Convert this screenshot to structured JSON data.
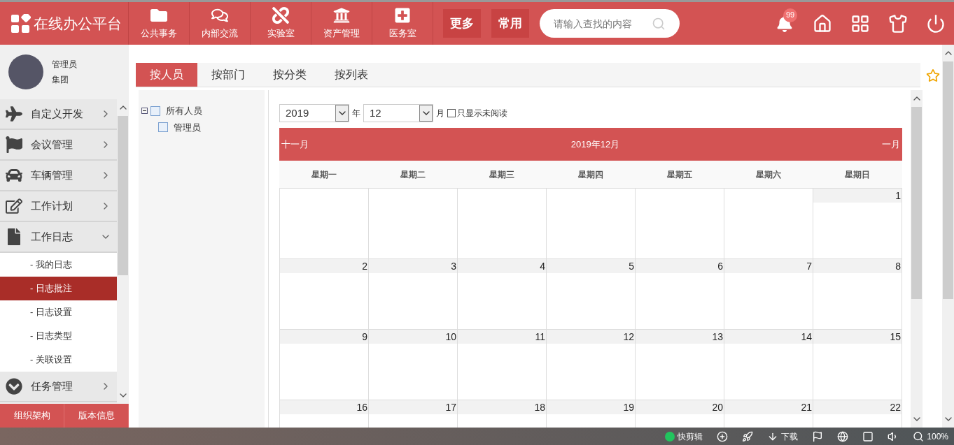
{
  "header": {
    "logo": "在线办公平台",
    "nav": [
      {
        "label": "公共事务"
      },
      {
        "label": "内部交流"
      },
      {
        "label": "实验室"
      },
      {
        "label": "资产管理"
      },
      {
        "label": "医务室"
      }
    ],
    "buttons": [
      {
        "label": "更多"
      },
      {
        "label": "常用"
      }
    ],
    "search": {
      "placeholder": "请输入查找的内容"
    },
    "notification_badge": "99"
  },
  "user": {
    "name": "管理员",
    "org": "集团"
  },
  "sidebar": {
    "items": [
      {
        "label": "自定义开发",
        "expanded": false
      },
      {
        "label": "会议管理",
        "expanded": false
      },
      {
        "label": "车辆管理",
        "expanded": false
      },
      {
        "label": "工作计划",
        "expanded": false
      },
      {
        "label": "工作日志",
        "expanded": true,
        "children": [
          {
            "label": "- 我的日志",
            "selected": false
          },
          {
            "label": "- 日志批注",
            "selected": true
          },
          {
            "label": "- 日志设置",
            "selected": false
          },
          {
            "label": "- 日志类型",
            "selected": false
          },
          {
            "label": "- 关联设置",
            "selected": false
          }
        ]
      },
      {
        "label": "任务管理",
        "expanded": false
      }
    ],
    "footer": [
      {
        "label": "组织架构"
      },
      {
        "label": "版本信息"
      }
    ]
  },
  "tabs": [
    {
      "label": "按人员",
      "selected": true
    },
    {
      "label": "按部门",
      "selected": false
    },
    {
      "label": "按分类",
      "selected": false
    },
    {
      "label": "按列表",
      "selected": false
    }
  ],
  "tree": {
    "label": "所有人员",
    "expanded": true,
    "children": [
      {
        "label": "管理员"
      }
    ]
  },
  "filter": {
    "year": "2019",
    "year_unit": "年",
    "month": "12",
    "month_unit": "月",
    "unread_only": {
      "label": "只显示未阅读",
      "checked": false
    }
  },
  "calendar": {
    "prev": "十一月",
    "title": "2019年12月",
    "next": "一月",
    "weekdays": [
      "星期一",
      "星期二",
      "星期三",
      "星期四",
      "星期五",
      "星期六",
      "星期日"
    ],
    "weeks": [
      [
        {
          "kind": "empty"
        },
        {
          "kind": "empty"
        },
        {
          "kind": "empty"
        },
        {
          "kind": "empty"
        },
        {
          "kind": "empty"
        },
        {
          "kind": "empty"
        },
        {
          "kind": "day",
          "day": "1"
        }
      ],
      [
        {
          "kind": "day",
          "day": "2"
        },
        {
          "kind": "day",
          "day": "3"
        },
        {
          "kind": "day",
          "day": "4"
        },
        {
          "kind": "day",
          "day": "5"
        },
        {
          "kind": "day",
          "day": "6"
        },
        {
          "kind": "day",
          "day": "7"
        },
        {
          "kind": "day",
          "day": "8"
        }
      ],
      [
        {
          "kind": "day",
          "day": "9"
        },
        {
          "kind": "day",
          "day": "10"
        },
        {
          "kind": "day",
          "day": "11"
        },
        {
          "kind": "day",
          "day": "12"
        },
        {
          "kind": "day",
          "day": "13"
        },
        {
          "kind": "day",
          "day": "14"
        },
        {
          "kind": "day",
          "day": "15"
        }
      ],
      [
        {
          "kind": "day",
          "day": "16"
        },
        {
          "kind": "day",
          "day": "17"
        },
        {
          "kind": "day",
          "day": "18"
        },
        {
          "kind": "day",
          "day": "19"
        },
        {
          "kind": "day",
          "day": "20"
        },
        {
          "kind": "day",
          "day": "21"
        },
        {
          "kind": "day",
          "day": "22"
        }
      ]
    ]
  },
  "status_bar": {
    "app": "快剪辑",
    "download": "下载",
    "zoom": "100%"
  }
}
